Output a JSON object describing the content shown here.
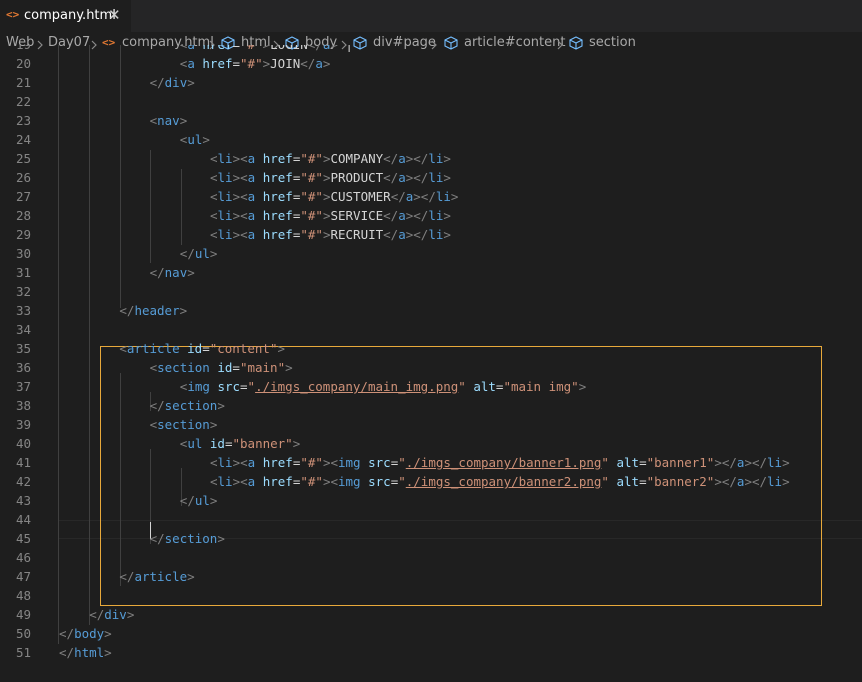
{
  "tab": {
    "icon": "<>",
    "title": "company.html",
    "close": "✕"
  },
  "breadcrumb": [
    "Web",
    "Day07",
    "company.html",
    "html",
    "body",
    "div#page",
    "article#content",
    "section"
  ],
  "lines": [
    {
      "n": "19",
      "tokens": [
        {
          "c": "t-br",
          "t": "<"
        },
        {
          "c": "t-tag",
          "t": "a "
        },
        {
          "c": "t-attr",
          "t": "href"
        },
        {
          "c": "t-txt",
          "t": "="
        },
        {
          "c": "t-str",
          "t": "\"#\""
        },
        {
          "c": "t-br",
          "t": ">"
        },
        {
          "c": "t-txt",
          "t": "LOGIN"
        },
        {
          "c": "t-br",
          "t": "</"
        },
        {
          "c": "t-tag",
          "t": "a"
        },
        {
          "c": "t-br",
          "t": ">"
        },
        {
          "c": "t-txt",
          "t": " |"
        }
      ]
    },
    {
      "n": "20",
      "tokens": [
        {
          "c": "t-br",
          "t": "<"
        },
        {
          "c": "t-tag",
          "t": "a "
        },
        {
          "c": "t-attr",
          "t": "href"
        },
        {
          "c": "t-txt",
          "t": "="
        },
        {
          "c": "t-str",
          "t": "\"#\""
        },
        {
          "c": "t-br",
          "t": ">"
        },
        {
          "c": "t-txt",
          "t": "JOIN"
        },
        {
          "c": "t-br",
          "t": "</"
        },
        {
          "c": "t-tag",
          "t": "a"
        },
        {
          "c": "t-br",
          "t": ">"
        }
      ]
    },
    {
      "n": "21",
      "tokens": [
        {
          "c": "t-br",
          "t": "</"
        },
        {
          "c": "t-tag",
          "t": "div"
        },
        {
          "c": "t-br",
          "t": ">"
        }
      ]
    },
    {
      "n": "22",
      "tokens": []
    },
    {
      "n": "23",
      "tokens": [
        {
          "c": "t-br",
          "t": "<"
        },
        {
          "c": "t-tag",
          "t": "nav"
        },
        {
          "c": "t-br",
          "t": ">"
        }
      ]
    },
    {
      "n": "24",
      "tokens": [
        {
          "c": "t-br",
          "t": "<"
        },
        {
          "c": "t-tag",
          "t": "ul"
        },
        {
          "c": "t-br",
          "t": ">"
        }
      ]
    },
    {
      "n": "25",
      "tokens": [
        {
          "c": "t-br",
          "t": "<"
        },
        {
          "c": "t-tag",
          "t": "li"
        },
        {
          "c": "t-br",
          "t": "><"
        },
        {
          "c": "t-tag",
          "t": "a "
        },
        {
          "c": "t-attr",
          "t": "href"
        },
        {
          "c": "t-txt",
          "t": "="
        },
        {
          "c": "t-str",
          "t": "\"#\""
        },
        {
          "c": "t-br",
          "t": ">"
        },
        {
          "c": "t-txt",
          "t": "COMPANY"
        },
        {
          "c": "t-br",
          "t": "</"
        },
        {
          "c": "t-tag",
          "t": "a"
        },
        {
          "c": "t-br",
          "t": "></"
        },
        {
          "c": "t-tag",
          "t": "li"
        },
        {
          "c": "t-br",
          "t": ">"
        }
      ]
    },
    {
      "n": "26",
      "tokens": [
        {
          "c": "t-br",
          "t": "<"
        },
        {
          "c": "t-tag",
          "t": "li"
        },
        {
          "c": "t-br",
          "t": "><"
        },
        {
          "c": "t-tag",
          "t": "a "
        },
        {
          "c": "t-attr",
          "t": "href"
        },
        {
          "c": "t-txt",
          "t": "="
        },
        {
          "c": "t-str",
          "t": "\"#\""
        },
        {
          "c": "t-br",
          "t": ">"
        },
        {
          "c": "t-txt",
          "t": "PRODUCT"
        },
        {
          "c": "t-br",
          "t": "</"
        },
        {
          "c": "t-tag",
          "t": "a"
        },
        {
          "c": "t-br",
          "t": "></"
        },
        {
          "c": "t-tag",
          "t": "li"
        },
        {
          "c": "t-br",
          "t": ">"
        }
      ]
    },
    {
      "n": "27",
      "tokens": [
        {
          "c": "t-br",
          "t": "<"
        },
        {
          "c": "t-tag",
          "t": "li"
        },
        {
          "c": "t-br",
          "t": "><"
        },
        {
          "c": "t-tag",
          "t": "a "
        },
        {
          "c": "t-attr",
          "t": "href"
        },
        {
          "c": "t-txt",
          "t": "="
        },
        {
          "c": "t-str",
          "t": "\"#\""
        },
        {
          "c": "t-br",
          "t": ">"
        },
        {
          "c": "t-txt",
          "t": "CUSTOMER"
        },
        {
          "c": "t-br",
          "t": "</"
        },
        {
          "c": "t-tag",
          "t": "a"
        },
        {
          "c": "t-br",
          "t": "></"
        },
        {
          "c": "t-tag",
          "t": "li"
        },
        {
          "c": "t-br",
          "t": ">"
        }
      ]
    },
    {
      "n": "28",
      "tokens": [
        {
          "c": "t-br",
          "t": "<"
        },
        {
          "c": "t-tag",
          "t": "li"
        },
        {
          "c": "t-br",
          "t": "><"
        },
        {
          "c": "t-tag",
          "t": "a "
        },
        {
          "c": "t-attr",
          "t": "href"
        },
        {
          "c": "t-txt",
          "t": "="
        },
        {
          "c": "t-str",
          "t": "\"#\""
        },
        {
          "c": "t-br",
          "t": ">"
        },
        {
          "c": "t-txt",
          "t": "SERVICE"
        },
        {
          "c": "t-br",
          "t": "</"
        },
        {
          "c": "t-tag",
          "t": "a"
        },
        {
          "c": "t-br",
          "t": "></"
        },
        {
          "c": "t-tag",
          "t": "li"
        },
        {
          "c": "t-br",
          "t": ">"
        }
      ]
    },
    {
      "n": "29",
      "tokens": [
        {
          "c": "t-br",
          "t": "<"
        },
        {
          "c": "t-tag",
          "t": "li"
        },
        {
          "c": "t-br",
          "t": "><"
        },
        {
          "c": "t-tag",
          "t": "a "
        },
        {
          "c": "t-attr",
          "t": "href"
        },
        {
          "c": "t-txt",
          "t": "="
        },
        {
          "c": "t-str",
          "t": "\"#\""
        },
        {
          "c": "t-br",
          "t": ">"
        },
        {
          "c": "t-txt",
          "t": "RECRUIT"
        },
        {
          "c": "t-br",
          "t": "</"
        },
        {
          "c": "t-tag",
          "t": "a"
        },
        {
          "c": "t-br",
          "t": "></"
        },
        {
          "c": "t-tag",
          "t": "li"
        },
        {
          "c": "t-br",
          "t": ">"
        }
      ]
    },
    {
      "n": "30",
      "tokens": [
        {
          "c": "t-br",
          "t": "</"
        },
        {
          "c": "t-tag",
          "t": "ul"
        },
        {
          "c": "t-br",
          "t": ">"
        }
      ]
    },
    {
      "n": "31",
      "tokens": [
        {
          "c": "t-br",
          "t": "</"
        },
        {
          "c": "t-tag",
          "t": "nav"
        },
        {
          "c": "t-br",
          "t": ">"
        }
      ]
    },
    {
      "n": "32",
      "tokens": []
    },
    {
      "n": "33",
      "tokens": [
        {
          "c": "t-br",
          "t": "</"
        },
        {
          "c": "t-tag",
          "t": "header"
        },
        {
          "c": "t-br",
          "t": ">"
        }
      ]
    },
    {
      "n": "34",
      "tokens": []
    },
    {
      "n": "35",
      "tokens": [
        {
          "c": "t-br",
          "t": "<"
        },
        {
          "c": "t-tag",
          "t": "article "
        },
        {
          "c": "t-attr",
          "t": "id"
        },
        {
          "c": "t-txt",
          "t": "="
        },
        {
          "c": "t-str",
          "t": "\"content\""
        },
        {
          "c": "t-br",
          "t": ">"
        }
      ]
    },
    {
      "n": "36",
      "tokens": [
        {
          "c": "t-br",
          "t": "<"
        },
        {
          "c": "t-tag",
          "t": "section "
        },
        {
          "c": "t-attr",
          "t": "id"
        },
        {
          "c": "t-txt",
          "t": "="
        },
        {
          "c": "t-str",
          "t": "\"main\""
        },
        {
          "c": "t-br",
          "t": ">"
        }
      ]
    },
    {
      "n": "37",
      "tokens": [
        {
          "c": "t-br",
          "t": "<"
        },
        {
          "c": "t-tag",
          "t": "img "
        },
        {
          "c": "t-attr",
          "t": "src"
        },
        {
          "c": "t-txt",
          "t": "="
        },
        {
          "c": "t-str",
          "t": "\""
        },
        {
          "c": "t-link",
          "t": "./imgs_company/main_img.png"
        },
        {
          "c": "t-str",
          "t": "\""
        },
        {
          "c": "t-txt",
          "t": " "
        },
        {
          "c": "t-attr",
          "t": "alt"
        },
        {
          "c": "t-txt",
          "t": "="
        },
        {
          "c": "t-str",
          "t": "\"main img\""
        },
        {
          "c": "t-br",
          "t": ">"
        }
      ]
    },
    {
      "n": "38",
      "tokens": [
        {
          "c": "t-br",
          "t": "</"
        },
        {
          "c": "t-tag",
          "t": "section"
        },
        {
          "c": "t-br",
          "t": ">"
        }
      ]
    },
    {
      "n": "39",
      "tokens": [
        {
          "c": "t-br",
          "t": "<"
        },
        {
          "c": "t-tag",
          "t": "section"
        },
        {
          "c": "t-br",
          "t": ">"
        }
      ]
    },
    {
      "n": "40",
      "tokens": [
        {
          "c": "t-br",
          "t": "<"
        },
        {
          "c": "t-tag",
          "t": "ul "
        },
        {
          "c": "t-attr",
          "t": "id"
        },
        {
          "c": "t-txt",
          "t": "="
        },
        {
          "c": "t-str",
          "t": "\"banner\""
        },
        {
          "c": "t-br",
          "t": ">"
        }
      ]
    },
    {
      "n": "41",
      "tokens": [
        {
          "c": "t-br",
          "t": "<"
        },
        {
          "c": "t-tag",
          "t": "li"
        },
        {
          "c": "t-br",
          "t": "><"
        },
        {
          "c": "t-tag",
          "t": "a "
        },
        {
          "c": "t-attr",
          "t": "href"
        },
        {
          "c": "t-txt",
          "t": "="
        },
        {
          "c": "t-str",
          "t": "\"#\""
        },
        {
          "c": "t-br",
          "t": "><"
        },
        {
          "c": "t-tag",
          "t": "img "
        },
        {
          "c": "t-attr",
          "t": "src"
        },
        {
          "c": "t-txt",
          "t": "="
        },
        {
          "c": "t-str",
          "t": "\""
        },
        {
          "c": "t-link",
          "t": "./imgs_company/banner1.png"
        },
        {
          "c": "t-str",
          "t": "\""
        },
        {
          "c": "t-txt",
          "t": " "
        },
        {
          "c": "t-attr",
          "t": "alt"
        },
        {
          "c": "t-txt",
          "t": "="
        },
        {
          "c": "t-str",
          "t": "\"banner1\""
        },
        {
          "c": "t-br",
          "t": "></"
        },
        {
          "c": "t-tag",
          "t": "a"
        },
        {
          "c": "t-br",
          "t": "></"
        },
        {
          "c": "t-tag",
          "t": "li"
        },
        {
          "c": "t-br",
          "t": ">"
        }
      ]
    },
    {
      "n": "42",
      "tokens": [
        {
          "c": "t-br",
          "t": "<"
        },
        {
          "c": "t-tag",
          "t": "li"
        },
        {
          "c": "t-br",
          "t": "><"
        },
        {
          "c": "t-tag",
          "t": "a "
        },
        {
          "c": "t-attr",
          "t": "href"
        },
        {
          "c": "t-txt",
          "t": "="
        },
        {
          "c": "t-str",
          "t": "\"#\""
        },
        {
          "c": "t-br",
          "t": "><"
        },
        {
          "c": "t-tag",
          "t": "img "
        },
        {
          "c": "t-attr",
          "t": "src"
        },
        {
          "c": "t-txt",
          "t": "="
        },
        {
          "c": "t-str",
          "t": "\""
        },
        {
          "c": "t-link",
          "t": "./imgs_company/banner2.png"
        },
        {
          "c": "t-str",
          "t": "\""
        },
        {
          "c": "t-txt",
          "t": " "
        },
        {
          "c": "t-attr",
          "t": "alt"
        },
        {
          "c": "t-txt",
          "t": "="
        },
        {
          "c": "t-str",
          "t": "\"banner2\""
        },
        {
          "c": "t-br",
          "t": "></"
        },
        {
          "c": "t-tag",
          "t": "a"
        },
        {
          "c": "t-br",
          "t": "></"
        },
        {
          "c": "t-tag",
          "t": "li"
        },
        {
          "c": "t-br",
          "t": ">"
        }
      ]
    },
    {
      "n": "43",
      "tokens": [
        {
          "c": "t-br",
          "t": "</"
        },
        {
          "c": "t-tag",
          "t": "ul"
        },
        {
          "c": "t-br",
          "t": ">"
        }
      ]
    },
    {
      "n": "44",
      "tokens": []
    },
    {
      "n": "45",
      "tokens": [
        {
          "c": "t-br",
          "t": "</"
        },
        {
          "c": "t-tag",
          "t": "section"
        },
        {
          "c": "t-br",
          "t": ">"
        }
      ]
    },
    {
      "n": "46",
      "tokens": []
    },
    {
      "n": "47",
      "tokens": [
        {
          "c": "t-br",
          "t": "</"
        },
        {
          "c": "t-tag",
          "t": "article"
        },
        {
          "c": "t-br",
          "t": ">"
        }
      ]
    },
    {
      "n": "48",
      "tokens": []
    },
    {
      "n": "49",
      "tokens": [
        {
          "c": "t-br",
          "t": "</"
        },
        {
          "c": "t-tag",
          "t": "div"
        },
        {
          "c": "t-br",
          "t": ">"
        }
      ]
    },
    {
      "n": "50",
      "tokens": [
        {
          "c": "t-br",
          "t": "</"
        },
        {
          "c": "t-tag",
          "t": "body"
        },
        {
          "c": "t-br",
          "t": ">"
        }
      ]
    },
    {
      "n": "51",
      "tokens": [
        {
          "c": "t-br",
          "t": "</"
        },
        {
          "c": "t-tag",
          "t": "html"
        },
        {
          "c": "t-br",
          "t": ">"
        }
      ]
    }
  ],
  "colors": {
    "tag": "#569cd6",
    "attr": "#9cdcfe",
    "string": "#ce9178",
    "bracket": "#808080",
    "highlight": "#e8a93b",
    "file_icon": "#e37933"
  },
  "icons": [
    "html-file-icon",
    "close-icon",
    "chevron-right-icon",
    "symbol-element-icon"
  ]
}
